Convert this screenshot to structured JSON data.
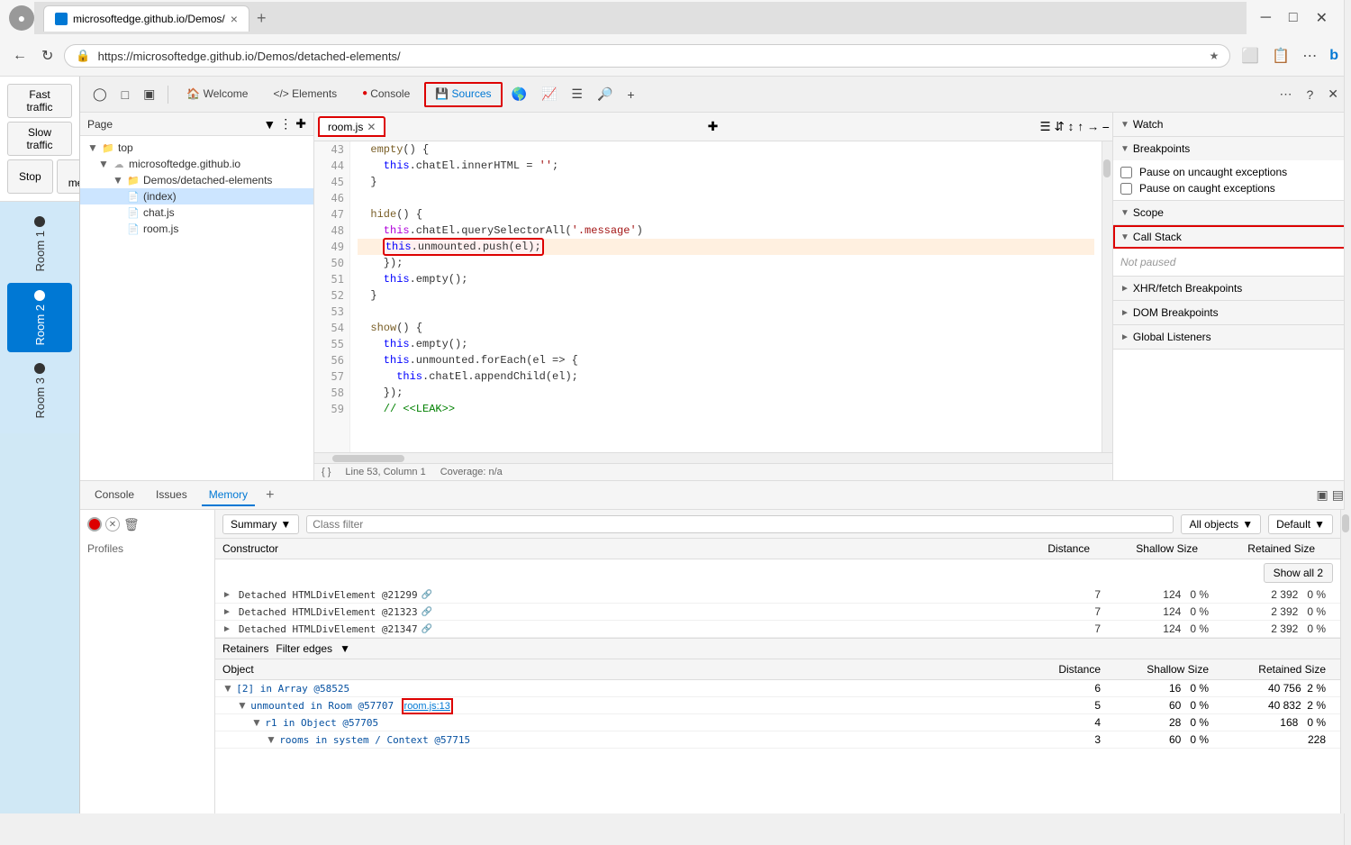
{
  "browser": {
    "title": "microsoftedge.github.io/Demos/",
    "tab_close": "×",
    "tab_add": "+",
    "url": "https://microsoftedge.github.io/Demos/detached-elements/",
    "nav_back": "←",
    "nav_forward": "→",
    "nav_refresh": "↻"
  },
  "app_buttons": {
    "fast_traffic": "Fast traffic",
    "slow_traffic": "Slow traffic",
    "stop": "Stop",
    "one_message": "One message"
  },
  "rooms": [
    {
      "id": "room1",
      "label": "Room 1",
      "active": false
    },
    {
      "id": "room2",
      "label": "Room 2",
      "active": true
    },
    {
      "id": "room3",
      "label": "Room 3",
      "active": false
    }
  ],
  "devtools": {
    "toolbar_icons": [
      "device_toggle",
      "responsive",
      "console_drawer"
    ],
    "tabs": [
      {
        "id": "welcome",
        "label": "Welcome"
      },
      {
        "id": "elements",
        "label": "Elements"
      },
      {
        "id": "console",
        "label": "Console"
      },
      {
        "id": "sources",
        "label": "Sources",
        "active": true
      },
      {
        "id": "network",
        "label": "Network"
      },
      {
        "id": "performance",
        "label": "Performance"
      },
      {
        "id": "memory",
        "label": "Memory"
      },
      {
        "id": "application",
        "label": "Application"
      }
    ],
    "more_tabs": "⋯",
    "help": "?",
    "close": "×",
    "file_tree": {
      "header": "Page",
      "items": [
        {
          "id": "top",
          "label": "top",
          "type": "folder",
          "level": 0
        },
        {
          "id": "origin",
          "label": "microsoftedge.github.io",
          "type": "domain",
          "level": 1
        },
        {
          "id": "demos_folder",
          "label": "Demos/detached-elements",
          "type": "folder_open",
          "level": 2
        },
        {
          "id": "index",
          "label": "(index)",
          "type": "html",
          "level": 3,
          "selected": true
        },
        {
          "id": "chat",
          "label": "chat.js",
          "type": "js",
          "level": 3
        },
        {
          "id": "room",
          "label": "room.js",
          "type": "js",
          "level": 3
        }
      ]
    },
    "editor": {
      "active_tab": "room.js",
      "lines": [
        {
          "num": 43,
          "code": "  empty() {"
        },
        {
          "num": 44,
          "code": "    this.chatEl.innerHTML = '';"
        },
        {
          "num": 45,
          "code": "  }"
        },
        {
          "num": 46,
          "code": ""
        },
        {
          "num": 47,
          "code": "  hide() {"
        },
        {
          "num": 48,
          "code": "    this.chatEl.querySelectorAll('.message')"
        },
        {
          "num": 49,
          "code": "    this.unmounted.push(el);"
        },
        {
          "num": 50,
          "code": "    });"
        },
        {
          "num": 51,
          "code": "    this.empty();"
        },
        {
          "num": 52,
          "code": "  }"
        },
        {
          "num": 53,
          "code": ""
        },
        {
          "num": 54,
          "code": "  show() {"
        },
        {
          "num": 55,
          "code": "    this.empty();"
        },
        {
          "num": 56,
          "code": "    this.unmounted.forEach(el => {"
        },
        {
          "num": 57,
          "code": "      this.chatEl.appendChild(el);"
        },
        {
          "num": 58,
          "code": "    });"
        },
        {
          "num": 59,
          "code": "    // <<LEAK>>"
        }
      ],
      "footer_line": "Line 53, Column 1",
      "footer_coverage": "Coverage: n/a"
    },
    "right_panel": {
      "watch": "Watch",
      "breakpoints": "Breakpoints",
      "pause_uncaught": "Pause on uncaught exceptions",
      "pause_caught": "Pause on caught exceptions",
      "scope": "Scope",
      "call_stack": "Call Stack",
      "not_paused": "Not paused",
      "xhr_breakpoints": "XHR/fetch Breakpoints",
      "dom_breakpoints": "DOM Breakpoints",
      "global_listeners": "Global Listeners"
    }
  },
  "memory_panel": {
    "tabs": [
      {
        "id": "console",
        "label": "Console"
      },
      {
        "id": "issues",
        "label": "Issues"
      },
      {
        "id": "memory",
        "label": "Memory",
        "active": true
      }
    ],
    "toolbar": {
      "view": "Summary",
      "view_dropdown": "▼",
      "class_filter": "Class filter",
      "objects": "All objects",
      "objects_dropdown": "▼",
      "default": "Default",
      "default_dropdown": "▼"
    },
    "table_headers": {
      "constructor": "Constructor",
      "distance": "Distance",
      "shallow_size": "Shallow Size",
      "retained_size": "Retained Size"
    },
    "show_all": "Show all 2",
    "rows": [
      {
        "constructor": "Detached HTMLDivElement @21299",
        "has_link": true,
        "distance": "7",
        "shallow": "124",
        "shallow_pct": "0 %",
        "retained": "2 392",
        "retained_pct": "0 %"
      },
      {
        "constructor": "Detached HTMLDivElement @21323",
        "has_link": true,
        "distance": "7",
        "shallow": "124",
        "shallow_pct": "0 %",
        "retained": "2 392",
        "retained_pct": "0 %"
      },
      {
        "constructor": "Detached HTMLDivElement @21347",
        "has_link": true,
        "distance": "7",
        "shallow": "124",
        "shallow_pct": "0 %",
        "retained": "2 392",
        "retained_pct": "0 %"
      }
    ],
    "retainers": {
      "header": "Retainers",
      "filter_edges": "Filter edges",
      "filter_dropdown": "▾",
      "table_headers": {
        "object": "Object",
        "distance": "Distance",
        "shallow_size": "Shallow Size",
        "retained_size": "Retained Size"
      },
      "rows": [
        {
          "indent": 0,
          "object": "[2] in Array @58525",
          "distance": "6",
          "shallow": "16",
          "shallow_pct": "0 %",
          "retained": "40 756",
          "retained_pct": "2 %"
        },
        {
          "indent": 1,
          "object": "unmounted in Room @57707",
          "link": "room.js:13",
          "distance": "5",
          "shallow": "60",
          "shallow_pct": "0 %",
          "retained": "40 832",
          "retained_pct": "2 %"
        },
        {
          "indent": 2,
          "object": "r1 in Object @57705",
          "distance": "4",
          "shallow": "28",
          "shallow_pct": "0 %",
          "retained": "168",
          "retained_pct": "0 %"
        },
        {
          "indent": 3,
          "object": "rooms in system / Context @57715",
          "distance": "3",
          "shallow": "60",
          "shallow_pct": "0 %",
          "retained": "228",
          "retained_pct": ""
        }
      ]
    },
    "profiles_label": "Profiles"
  }
}
